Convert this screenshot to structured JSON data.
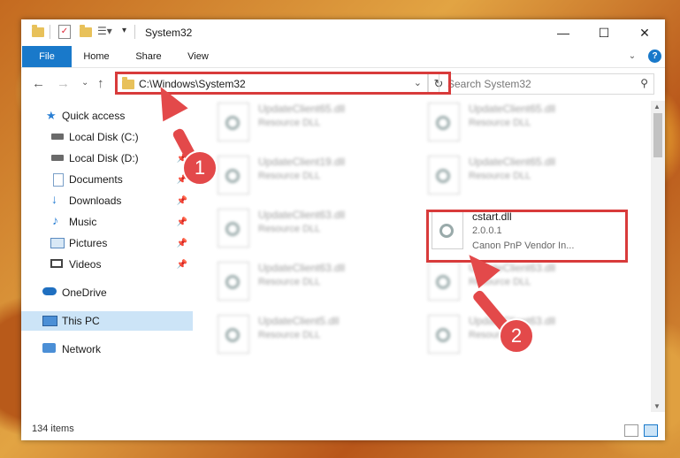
{
  "window": {
    "title": "System32"
  },
  "ribbon": {
    "file": "File",
    "home": "Home",
    "share": "Share",
    "view": "View",
    "help": "?"
  },
  "address": {
    "path": "C:\\Windows\\System32",
    "search_placeholder": "Search System32"
  },
  "sidebar": {
    "items": [
      {
        "label": "Quick access"
      },
      {
        "label": "Local Disk (C:)"
      },
      {
        "label": "Local Disk (D:)"
      },
      {
        "label": "Documents"
      },
      {
        "label": "Downloads"
      },
      {
        "label": "Music"
      },
      {
        "label": "Pictures"
      },
      {
        "label": "Videos"
      },
      {
        "label": "OneDrive"
      },
      {
        "label": "This PC"
      },
      {
        "label": "Network"
      }
    ]
  },
  "files": {
    "col1": [
      {
        "name": "UpdateClient65.dll",
        "type": "Resource DLL"
      },
      {
        "name": "UpdateClient19.dll",
        "type": "Resource DLL"
      },
      {
        "name": "UpdateClient63.dll",
        "type": "Resource DLL"
      },
      {
        "name": "UpdateClient63.dll",
        "type": "Resource DLL"
      },
      {
        "name": "UpdateClient5.dll",
        "type": "Resource DLL"
      }
    ],
    "col2": [
      {
        "name": "UpdateClient65.dll",
        "type": "Resource DLL"
      },
      {
        "name": "UpdateClient65.dll",
        "type": "Resource DLL"
      },
      {
        "name": "UpdateClient63.dll",
        "type": "Resource DLL"
      },
      {
        "name": "UpdateClient63.dll",
        "type": "Resource DLL"
      }
    ],
    "highlight": {
      "name": "cstart.dll",
      "version": "2.0.0.1",
      "company": "Canon PnP Vendor In..."
    }
  },
  "status": {
    "count": "134 items"
  },
  "annotations": {
    "badge1": "1",
    "badge2": "2"
  },
  "colors": {
    "accent": "#1979ca",
    "annotation": "#e3494a",
    "selection": "#cce4f7"
  }
}
